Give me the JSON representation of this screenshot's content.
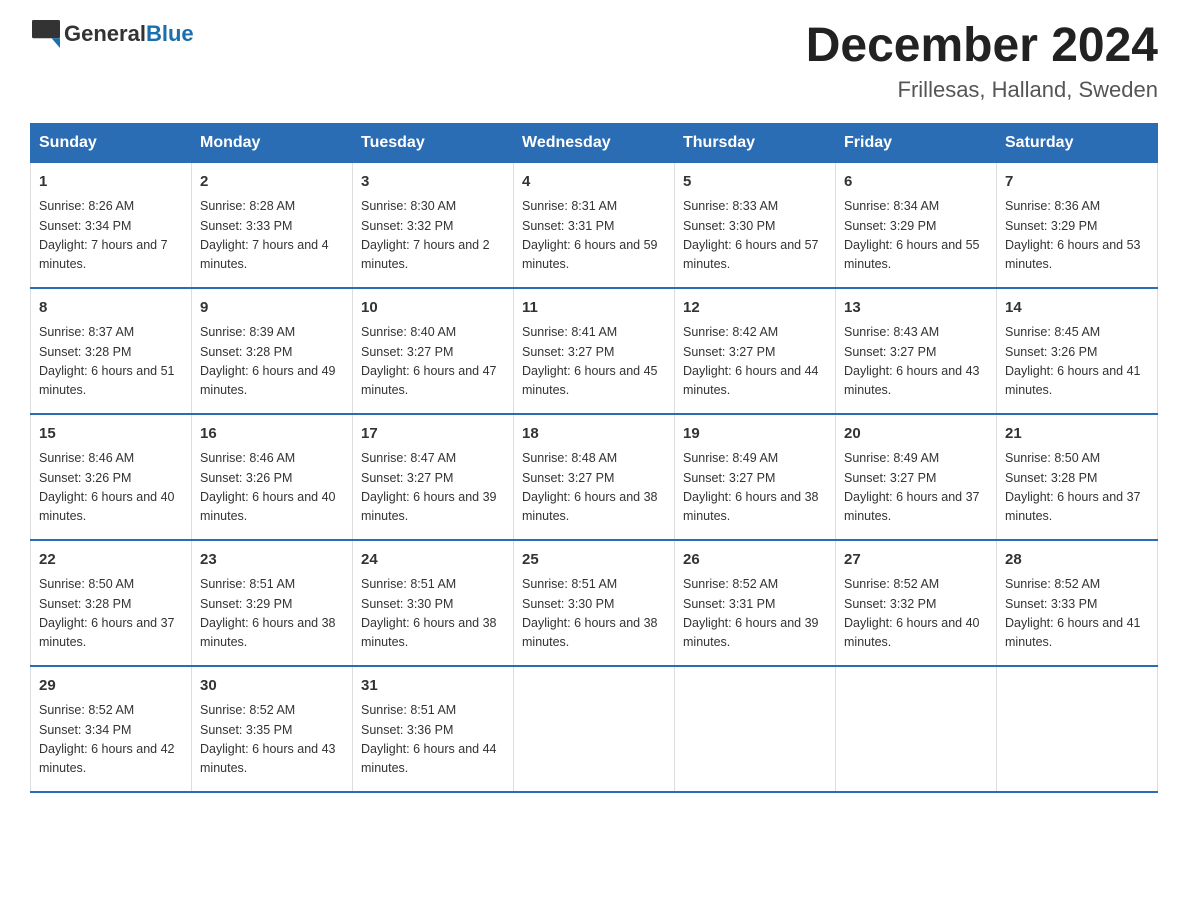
{
  "header": {
    "logo_general": "General",
    "logo_blue": "Blue",
    "title": "December 2024",
    "subtitle": "Frillesas, Halland, Sweden"
  },
  "days_of_week": [
    "Sunday",
    "Monday",
    "Tuesday",
    "Wednesday",
    "Thursday",
    "Friday",
    "Saturday"
  ],
  "weeks": [
    [
      {
        "day": "1",
        "sunrise": "8:26 AM",
        "sunset": "3:34 PM",
        "daylight": "7 hours and 7 minutes."
      },
      {
        "day": "2",
        "sunrise": "8:28 AM",
        "sunset": "3:33 PM",
        "daylight": "7 hours and 4 minutes."
      },
      {
        "day": "3",
        "sunrise": "8:30 AM",
        "sunset": "3:32 PM",
        "daylight": "7 hours and 2 minutes."
      },
      {
        "day": "4",
        "sunrise": "8:31 AM",
        "sunset": "3:31 PM",
        "daylight": "6 hours and 59 minutes."
      },
      {
        "day": "5",
        "sunrise": "8:33 AM",
        "sunset": "3:30 PM",
        "daylight": "6 hours and 57 minutes."
      },
      {
        "day": "6",
        "sunrise": "8:34 AM",
        "sunset": "3:29 PM",
        "daylight": "6 hours and 55 minutes."
      },
      {
        "day": "7",
        "sunrise": "8:36 AM",
        "sunset": "3:29 PM",
        "daylight": "6 hours and 53 minutes."
      }
    ],
    [
      {
        "day": "8",
        "sunrise": "8:37 AM",
        "sunset": "3:28 PM",
        "daylight": "6 hours and 51 minutes."
      },
      {
        "day": "9",
        "sunrise": "8:39 AM",
        "sunset": "3:28 PM",
        "daylight": "6 hours and 49 minutes."
      },
      {
        "day": "10",
        "sunrise": "8:40 AM",
        "sunset": "3:27 PM",
        "daylight": "6 hours and 47 minutes."
      },
      {
        "day": "11",
        "sunrise": "8:41 AM",
        "sunset": "3:27 PM",
        "daylight": "6 hours and 45 minutes."
      },
      {
        "day": "12",
        "sunrise": "8:42 AM",
        "sunset": "3:27 PM",
        "daylight": "6 hours and 44 minutes."
      },
      {
        "day": "13",
        "sunrise": "8:43 AM",
        "sunset": "3:27 PM",
        "daylight": "6 hours and 43 minutes."
      },
      {
        "day": "14",
        "sunrise": "8:45 AM",
        "sunset": "3:26 PM",
        "daylight": "6 hours and 41 minutes."
      }
    ],
    [
      {
        "day": "15",
        "sunrise": "8:46 AM",
        "sunset": "3:26 PM",
        "daylight": "6 hours and 40 minutes."
      },
      {
        "day": "16",
        "sunrise": "8:46 AM",
        "sunset": "3:26 PM",
        "daylight": "6 hours and 40 minutes."
      },
      {
        "day": "17",
        "sunrise": "8:47 AM",
        "sunset": "3:27 PM",
        "daylight": "6 hours and 39 minutes."
      },
      {
        "day": "18",
        "sunrise": "8:48 AM",
        "sunset": "3:27 PM",
        "daylight": "6 hours and 38 minutes."
      },
      {
        "day": "19",
        "sunrise": "8:49 AM",
        "sunset": "3:27 PM",
        "daylight": "6 hours and 38 minutes."
      },
      {
        "day": "20",
        "sunrise": "8:49 AM",
        "sunset": "3:27 PM",
        "daylight": "6 hours and 37 minutes."
      },
      {
        "day": "21",
        "sunrise": "8:50 AM",
        "sunset": "3:28 PM",
        "daylight": "6 hours and 37 minutes."
      }
    ],
    [
      {
        "day": "22",
        "sunrise": "8:50 AM",
        "sunset": "3:28 PM",
        "daylight": "6 hours and 37 minutes."
      },
      {
        "day": "23",
        "sunrise": "8:51 AM",
        "sunset": "3:29 PM",
        "daylight": "6 hours and 38 minutes."
      },
      {
        "day": "24",
        "sunrise": "8:51 AM",
        "sunset": "3:30 PM",
        "daylight": "6 hours and 38 minutes."
      },
      {
        "day": "25",
        "sunrise": "8:51 AM",
        "sunset": "3:30 PM",
        "daylight": "6 hours and 38 minutes."
      },
      {
        "day": "26",
        "sunrise": "8:52 AM",
        "sunset": "3:31 PM",
        "daylight": "6 hours and 39 minutes."
      },
      {
        "day": "27",
        "sunrise": "8:52 AM",
        "sunset": "3:32 PM",
        "daylight": "6 hours and 40 minutes."
      },
      {
        "day": "28",
        "sunrise": "8:52 AM",
        "sunset": "3:33 PM",
        "daylight": "6 hours and 41 minutes."
      }
    ],
    [
      {
        "day": "29",
        "sunrise": "8:52 AM",
        "sunset": "3:34 PM",
        "daylight": "6 hours and 42 minutes."
      },
      {
        "day": "30",
        "sunrise": "8:52 AM",
        "sunset": "3:35 PM",
        "daylight": "6 hours and 43 minutes."
      },
      {
        "day": "31",
        "sunrise": "8:51 AM",
        "sunset": "3:36 PM",
        "daylight": "6 hours and 44 minutes."
      },
      {
        "day": "",
        "sunrise": "",
        "sunset": "",
        "daylight": ""
      },
      {
        "day": "",
        "sunrise": "",
        "sunset": "",
        "daylight": ""
      },
      {
        "day": "",
        "sunrise": "",
        "sunset": "",
        "daylight": ""
      },
      {
        "day": "",
        "sunrise": "",
        "sunset": "",
        "daylight": ""
      }
    ]
  ],
  "labels": {
    "sunrise_prefix": "Sunrise: ",
    "sunset_prefix": "Sunset: ",
    "daylight_prefix": "Daylight: "
  }
}
